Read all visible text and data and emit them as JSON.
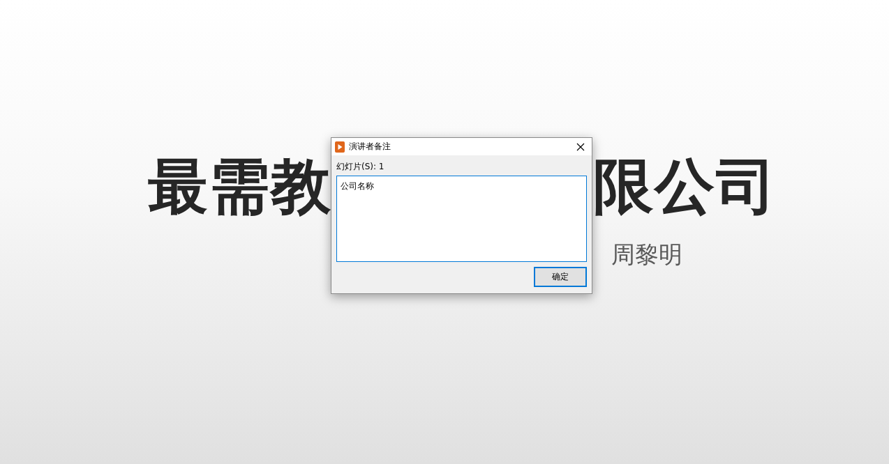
{
  "slide": {
    "title_left": "最需教",
    "title_right": "限公司",
    "subtitle": "周黎明"
  },
  "dialog": {
    "title": "演讲者备注",
    "slide_label": "幻灯片(S): 1",
    "notes": {
      "value": "公司名称"
    },
    "buttons": [
      {
        "label": "确定",
        "kind": "default"
      }
    ]
  }
}
